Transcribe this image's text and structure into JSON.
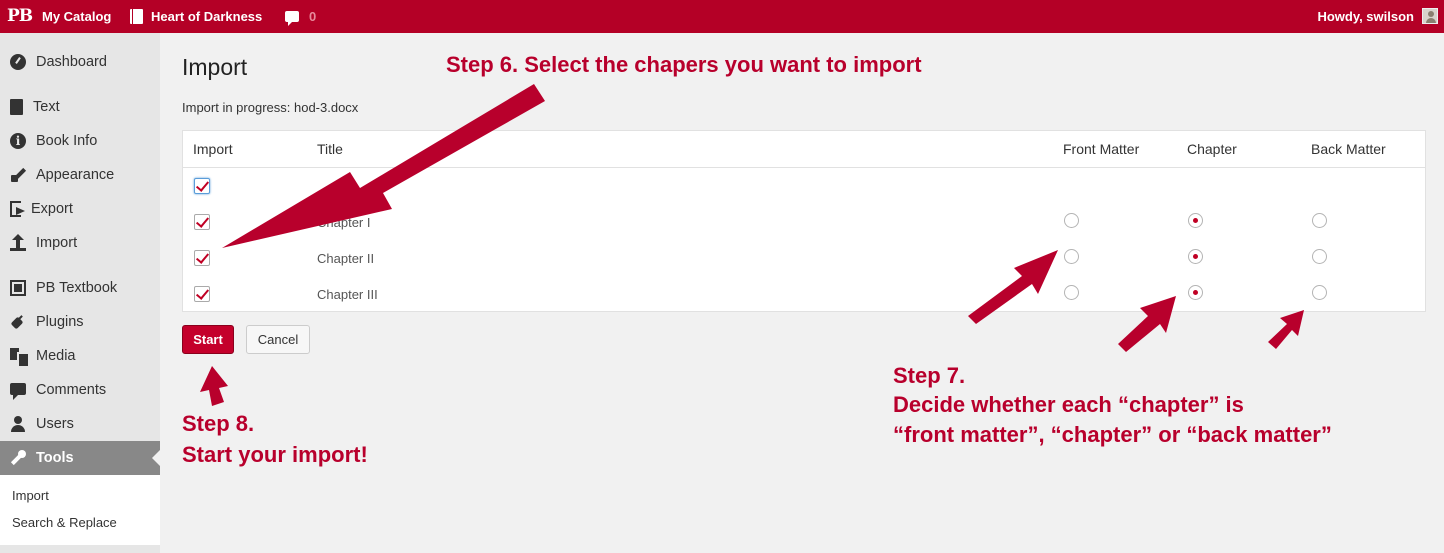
{
  "adminbar": {
    "logo": "PB",
    "catalog": "My Catalog",
    "book_title": "Heart of Darkness",
    "comment_count": "0",
    "greeting": "Howdy, swilson"
  },
  "sidebar": {
    "items": [
      {
        "label": "Dashboard",
        "icon": "dashboard-icon"
      },
      {
        "label": "Text",
        "icon": "book-icon"
      },
      {
        "label": "Book Info",
        "icon": "info-icon"
      },
      {
        "label": "Appearance",
        "icon": "brush-icon"
      },
      {
        "label": "Export",
        "icon": "export-icon"
      },
      {
        "label": "Import",
        "icon": "import-icon"
      },
      {
        "label": "PB Textbook",
        "icon": "textbook-icon"
      },
      {
        "label": "Plugins",
        "icon": "plugin-icon"
      },
      {
        "label": "Media",
        "icon": "media-icon"
      },
      {
        "label": "Comments",
        "icon": "comment-icon"
      },
      {
        "label": "Users",
        "icon": "user-icon"
      },
      {
        "label": "Tools",
        "icon": "wrench-icon"
      }
    ],
    "submenu": [
      "Import",
      "Search & Replace"
    ]
  },
  "main": {
    "title": "Import",
    "progress_text": "Import in progress: hod-3.docx",
    "columns": [
      "Import",
      "Title",
      "Front Matter",
      "Chapter",
      "Back Matter"
    ],
    "rows": [
      {
        "title": "",
        "checked": true,
        "type": null
      },
      {
        "title": "Chapter I",
        "checked": true,
        "type": "chapter"
      },
      {
        "title": "Chapter II",
        "checked": true,
        "type": "chapter"
      },
      {
        "title": "Chapter III",
        "checked": true,
        "type": "chapter"
      }
    ],
    "start_label": "Start",
    "cancel_label": "Cancel"
  },
  "annotations": {
    "step6": "Step 6.  Select the chapers you want to import",
    "step7_line1": "Step 7.",
    "step7_line2": "Decide whether each “chapter” is",
    "step7_line3": "“front matter”, “chapter” or “back matter”",
    "step8_line1": "Step 8.",
    "step8_line2": "Start your import!"
  },
  "colors": {
    "brand": "#b40026",
    "annotation": "#b8002c"
  }
}
